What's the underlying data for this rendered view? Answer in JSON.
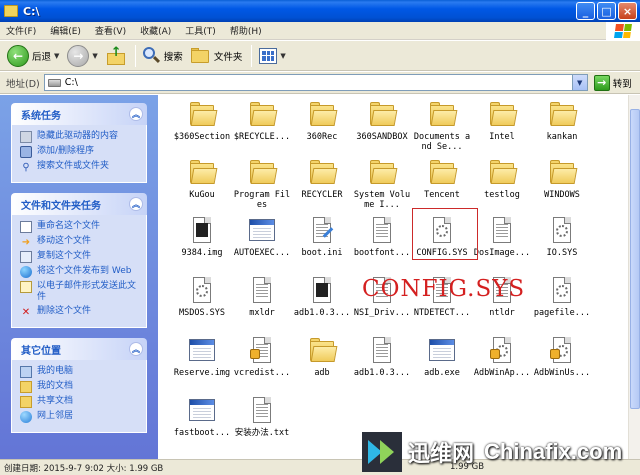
{
  "window": {
    "title": "C:\\"
  },
  "menu": [
    "文件(F)",
    "编辑(E)",
    "查看(V)",
    "收藏(A)",
    "工具(T)",
    "帮助(H)"
  ],
  "toolbar": {
    "back": "后退",
    "search": "搜索",
    "folders": "文件夹"
  },
  "address": {
    "label": "地址(D)",
    "value": "C:\\",
    "go": "转到"
  },
  "panels": {
    "system": {
      "title": "系统任务",
      "items": [
        "隐藏此驱动器的内容",
        "添加/删除程序",
        "搜索文件或文件夹"
      ]
    },
    "file": {
      "title": "文件和文件夹任务",
      "items": [
        "重命名这个文件",
        "移动这个文件",
        "复制这个文件",
        "将这个文件发布到 Web",
        "以电子邮件形式发送此文件",
        "删除这个文件"
      ]
    },
    "other": {
      "title": "其它位置",
      "items": [
        "我的电脑",
        "我的文档",
        "共享文档",
        "网上邻居"
      ]
    }
  },
  "files": [
    "$360Section",
    "$RECYCLE...",
    "360Rec",
    "360SANDBOX",
    "Documents and Se...",
    "Intel",
    "kankan",
    "KuGou",
    "Program Files",
    "RECYCLER",
    "System Volume I...",
    "Tencent",
    "testlog",
    "WINDOWS",
    "9384.img",
    "AUTOEXEC...",
    "boot.ini",
    "bootfont...",
    "CONFIG.SYS",
    "DosImage...",
    "IO.SYS",
    "MSDOS.SYS",
    "mxldr",
    "adb1.0.3...",
    "NSI_Driv...",
    "NTDETECT...",
    "ntldr",
    "pagefile...",
    "Reserve.img",
    "vcredist...",
    "adb",
    "adb1.0.3...",
    "adb.exe",
    "AdbWinAp...",
    "AdbWinUs...",
    "fastboot...",
    "安装办法.txt"
  ],
  "caption": "CONFIG.SYS",
  "status": {
    "left": "创建日期: 2015-9-7 9:02 大小: 1.99 GB",
    "right": "1.99 GB"
  },
  "watermark": {
    "cn": "迅维网",
    "en": "Chinafix.com"
  },
  "colors": {
    "titlebar": "#0058e6",
    "panel_bg": "#6f8fe0",
    "highlight": "#cc2a2a",
    "link": "#215dc6"
  }
}
